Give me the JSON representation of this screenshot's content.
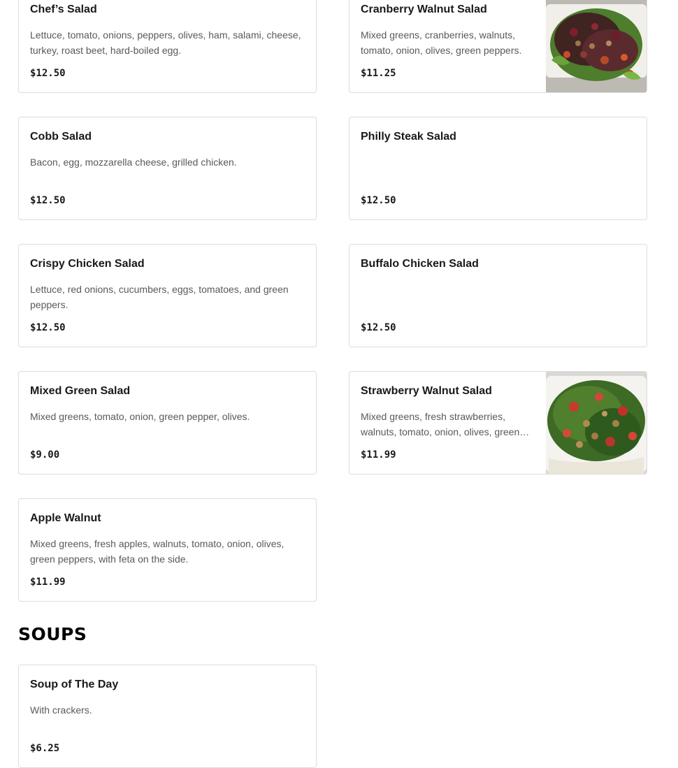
{
  "salads": [
    {
      "name": "Chef’s Salad",
      "description": "Lettuce, tomato, onions, peppers, olives, ham, salami, cheese, turkey, roast beet, hard-boiled egg.",
      "price": "$12.50"
    },
    {
      "name": "Cranberry Walnut Salad",
      "description": "Mixed greens, cranberries, walnuts, tomato, onion, olives, green peppers.",
      "price": "$11.25"
    },
    {
      "name": "Cobb Salad",
      "description": "Bacon, egg, mozzarella cheese, grilled chicken.",
      "price": "$12.50"
    },
    {
      "name": "Philly Steak Salad",
      "description": "",
      "price": "$12.50"
    },
    {
      "name": "Crispy Chicken Salad",
      "description": "Lettuce, red onions, cucumbers, eggs, tomatoes, and green peppers.",
      "price": "$12.50"
    },
    {
      "name": "Buffalo Chicken Salad",
      "description": "",
      "price": "$12.50"
    },
    {
      "name": "Mixed Green Salad",
      "description": "Mixed greens, tomato, onion, green pepper, olives.",
      "price": "$9.00"
    },
    {
      "name": "Strawberry Walnut Salad",
      "description": "Mixed greens, fresh strawberries, walnuts, tomato, onion, olives, green peppers.",
      "price": "$11.99"
    },
    {
      "name": "Apple Walnut",
      "description": "Mixed greens, fresh apples, walnuts, tomato, onion, olives, green peppers, with feta on the side.",
      "price": "$11.99"
    }
  ],
  "soups_section": {
    "title": "SOUPS"
  },
  "soups": [
    {
      "name": "Soup of The Day",
      "description": "With crackers.",
      "price": "$6.25"
    }
  ]
}
